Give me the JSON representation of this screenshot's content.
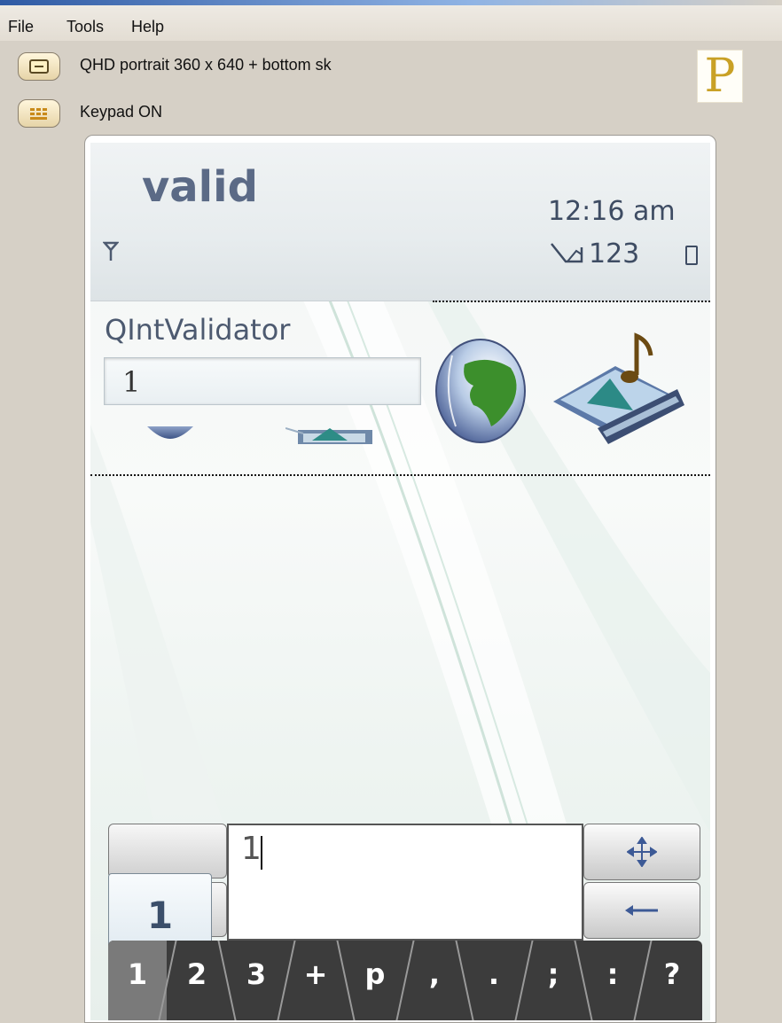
{
  "menu": {
    "file": "File",
    "tools": "Tools",
    "help": "Help"
  },
  "toolbar": {
    "orientation_label": "QHD portrait 360 x 640 + bottom sk",
    "keypad_label": "Keypad ON",
    "logo_letter": "P"
  },
  "status": {
    "app_title": "valid",
    "time": "12:16 am",
    "input_mode": "123"
  },
  "form": {
    "validator_label": "QIntValidator",
    "field_value": "1"
  },
  "vkb": {
    "preview_char": "1",
    "edit_text": "1",
    "keys": [
      "1",
      "2",
      "3",
      "+",
      "p",
      ",",
      ".",
      ";",
      ":",
      "?"
    ],
    "active_key": "1"
  },
  "colors": {
    "accent_title": "#5b6a86",
    "logo_gold": "#c9a126"
  }
}
